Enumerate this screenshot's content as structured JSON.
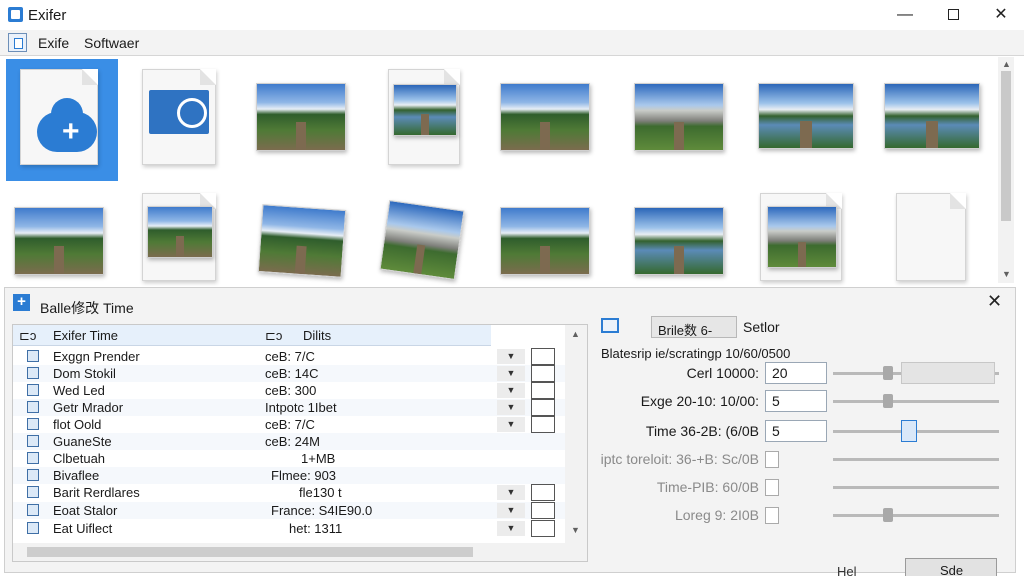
{
  "window": {
    "title": "Exifer",
    "min": "—",
    "close": "✕"
  },
  "menu": {
    "items": [
      "Exife",
      "Softwaer"
    ]
  },
  "panel": {
    "title": "Balle修改 Time",
    "close": "✕"
  },
  "table": {
    "headers": [
      "Exifer Time",
      "Dilits"
    ],
    "rows": [
      {
        "name": "Exggn Prender",
        "value": "ceB: 7/C"
      },
      {
        "name": "Dom Stokil",
        "value": "ceB: 14C"
      },
      {
        "name": "Wed Led",
        "value": "ceB: 300"
      },
      {
        "name": "Getr Mrador",
        "value": "Intpotc 1Ibet"
      },
      {
        "name": "flot Oold",
        "value": "ceB: 7/C"
      },
      {
        "name": "GuaneSte",
        "value": "ceB: 24M"
      },
      {
        "name": "Clbetuah",
        "value": "1+MB"
      },
      {
        "name": "Bivaflee",
        "value": "Flmee: 903"
      },
      {
        "name": "Barit Rerdlares",
        "value": "fle130 t"
      },
      {
        "name": "Eoat Stalor",
        "value": "France: S4IE90.0"
      },
      {
        "name": "Eat Uiflect",
        "value": "het: 1311"
      }
    ]
  },
  "settings": {
    "tab_label": "Brile数 6-",
    "tab_suffix": "Setlor",
    "header": "Blatesrip ie/scratingp 10/60/0500",
    "rows": [
      {
        "label": "Cerl 10000:",
        "value": "20"
      },
      {
        "label": "Exge 20-10: 10/00:",
        "value": "5"
      },
      {
        "label": "Time 36-2B: (6/0B",
        "value": "5"
      },
      {
        "label": "iptc toreloit: 36-+B: Sc/0B",
        "value": ""
      },
      {
        "label": "Time-PIB: 60/0B",
        "value": ""
      },
      {
        "label": "Loreg 9: 2I0B",
        "value": ""
      }
    ],
    "help_label": "Hel",
    "save_label": "Sde"
  }
}
